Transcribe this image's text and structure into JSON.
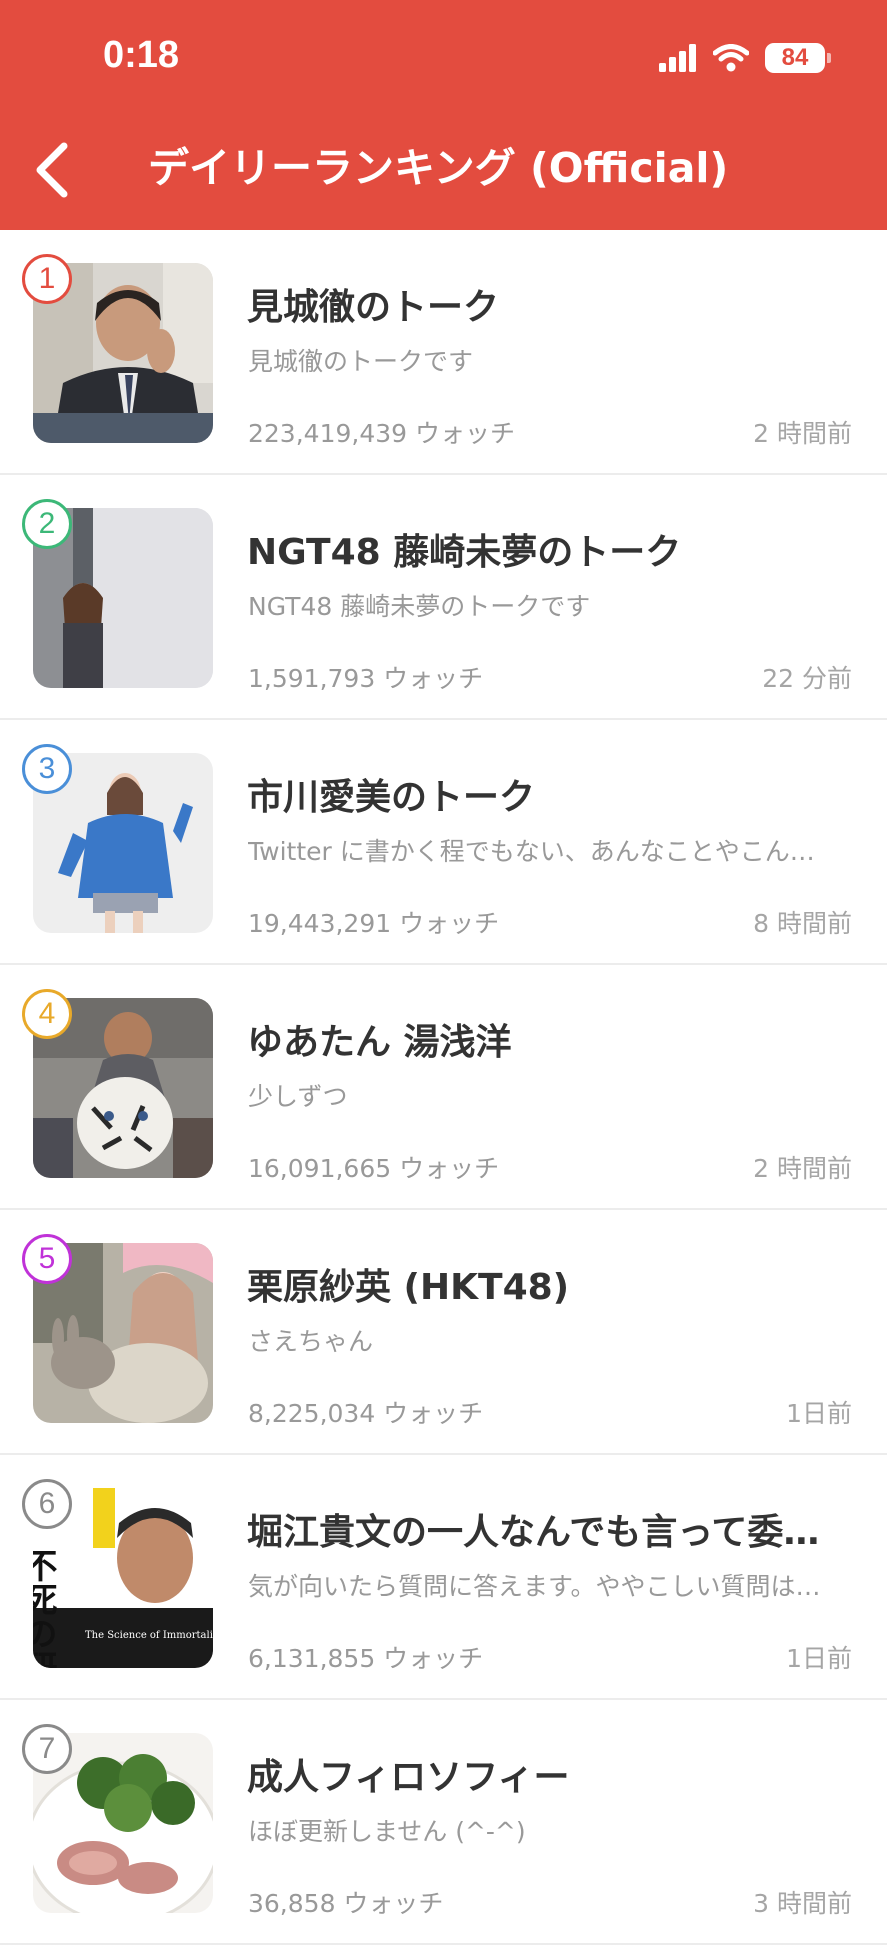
{
  "status_bar": {
    "time": "0:18",
    "battery": "84"
  },
  "header": {
    "title": "デイリーランキング (Official)",
    "back_icon": "chevron-left-icon"
  },
  "colors": {
    "header_bg": "#e34c3f",
    "rank_colors": [
      "#e34c3f",
      "#3cb878",
      "#4a8fd8",
      "#e8a92a",
      "#c032d8",
      "#8a8a8a",
      "#8a8a8a"
    ]
  },
  "rankings": [
    {
      "rank": "1",
      "title": "見城徹のトーク",
      "description": "見城徹のトークです",
      "watchers": "223,419,439 ウォッチ",
      "updated": "2 時間前"
    },
    {
      "rank": "2",
      "title": "NGT48 藤崎未夢のトーク",
      "description": "NGT48 藤崎未夢のトークです",
      "watchers": "1,591,793 ウォッチ",
      "updated": "22 分前"
    },
    {
      "rank": "3",
      "title": "市川愛美のトーク",
      "description": "Twitter に書かく程でもない、あんなことやこん…",
      "watchers": "19,443,291 ウォッチ",
      "updated": "8 時間前"
    },
    {
      "rank": "4",
      "title": "ゆあたん 湯浅洋",
      "description": "少しずつ",
      "watchers": "16,091,665 ウォッチ",
      "updated": "2 時間前"
    },
    {
      "rank": "5",
      "title": "栗原紗英 (HKT48)",
      "description": "さえちゃん",
      "watchers": "8,225,034 ウォッチ",
      "updated": "1日前"
    },
    {
      "rank": "6",
      "title": "堀江貴文の一人なんでも言って委…",
      "description": "気が向いたら質問に答えます。ややこしい質問は…",
      "watchers": "6,131,855 ウォッチ",
      "updated": "1日前"
    },
    {
      "rank": "7",
      "title": "成人フィロソフィー",
      "description": "ほぼ更新しません (^-^)",
      "watchers": "36,858 ウォッチ",
      "updated": "3 時間前"
    }
  ],
  "thumb6_text": {
    "main": "不死の研究",
    "sub": "The Science of Immortality"
  }
}
